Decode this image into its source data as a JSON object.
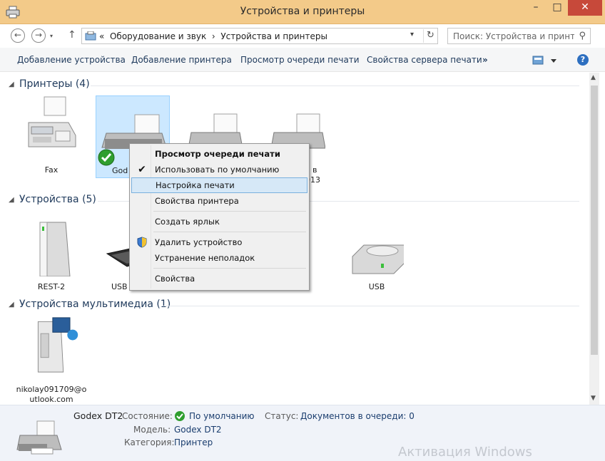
{
  "window": {
    "title": "Устройства и принтеры"
  },
  "nav": {
    "back_glyph": "←",
    "forward_glyph": "→",
    "up_glyph": "↑",
    "address_prefix": "«",
    "breadcrumb": [
      "Оборудование и звук",
      "Устройства и принтеры"
    ],
    "breadcrumb_sep": "›",
    "search_placeholder": "Поиск: Устройства и принте..."
  },
  "commands": [
    "Добавление устройства",
    "Добавление принтера",
    "Просмотр очереди печати",
    "Свойства сервера печати",
    "»"
  ],
  "sections": [
    {
      "title": "Принтеры (4)"
    },
    {
      "title": "Устройства (5)"
    },
    {
      "title": "Устройства мультимедиа (1)"
    }
  ],
  "printers": [
    {
      "label": "Fax",
      "icon": "fax-icon"
    },
    {
      "label": "God",
      "icon": "printer-icon"
    },
    {
      "label": "",
      "icon": "printer-icon"
    },
    {
      "label": "ь в",
      "label2": "013",
      "icon": "printer-icon"
    }
  ],
  "devices": [
    {
      "label": "REST-2",
      "icon": "external-drive-icon"
    },
    {
      "label": "USB",
      "icon": "keyboard-icon"
    },
    {
      "label": "USB",
      "icon": "usb-drive-icon"
    }
  ],
  "multimedia": [
    {
      "label": "nikolay091709@o",
      "label2": "utlook.com",
      "icon": "media-device-icon"
    }
  ],
  "context_menu": {
    "items": [
      {
        "label": "Просмотр очереди печати",
        "bold": true
      },
      {
        "label": "Использовать по умолчанию",
        "checked": true
      },
      {
        "label": "Настройка печати",
        "highlighted": true
      },
      {
        "label": "Свойства принтера"
      },
      {
        "label": "Создать ярлык"
      },
      {
        "label": "Удалить устройство",
        "icon": "shield-icon"
      },
      {
        "label": "Устранение неполадок"
      },
      {
        "label": "Свойства"
      }
    ]
  },
  "details": {
    "name": "Godex DT2",
    "state_label": "Состояние:",
    "state_value": "По умолчанию",
    "status_label": "Статус:",
    "status_value": "Документов в очереди: 0",
    "model_label": "Модель:",
    "model_value": "Godex DT2",
    "category_label": "Категория:",
    "category_value": "Принтер"
  },
  "watermark": "Активация Windows",
  "colors": {
    "titlebar": "#f3ca89",
    "close": "#c7493a",
    "link": "#1e395b",
    "selection": "#cce8ff"
  }
}
